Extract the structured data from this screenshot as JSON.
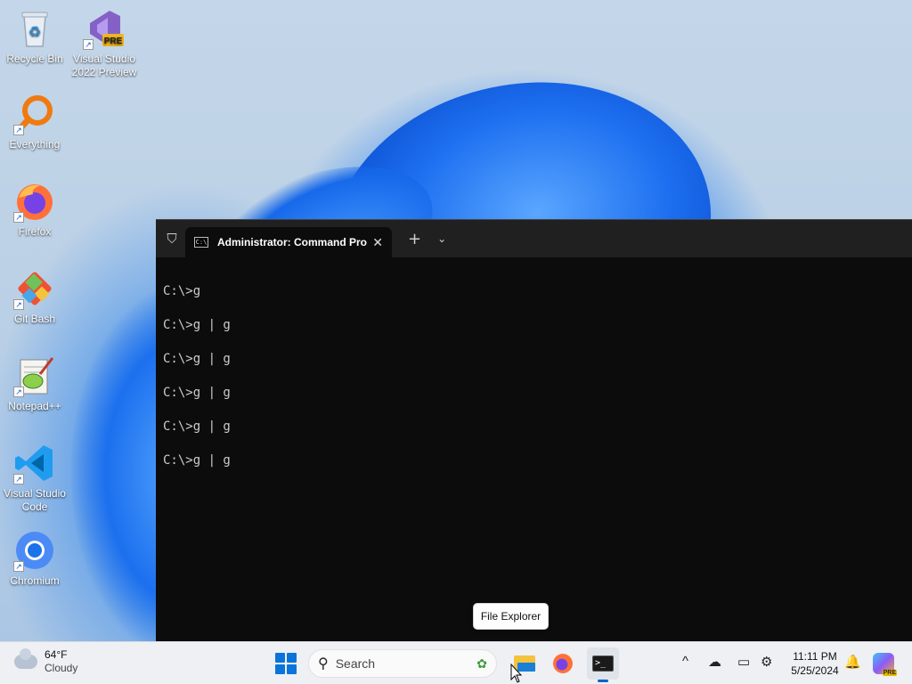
{
  "desktop": {
    "icons": [
      {
        "label": "Recycle Bin",
        "icon": "recycle-bin-icon"
      },
      {
        "label": "Visual Studio 2022 Preview",
        "icon": "visual-studio-preview-icon",
        "badge": "PRE"
      },
      {
        "label": "Everything",
        "icon": "everything-search-icon"
      },
      {
        "label": "Firefox",
        "icon": "firefox-icon"
      },
      {
        "label": "Git Bash",
        "icon": "git-bash-icon"
      },
      {
        "label": "Notepad++",
        "icon": "notepad-plus-plus-icon"
      },
      {
        "label": "Visual Studio Code",
        "icon": "vscode-icon"
      },
      {
        "label": "Chromium",
        "icon": "chromium-icon"
      }
    ]
  },
  "terminal": {
    "tab_title": "Administrator: Command Pro",
    "tab_icon_text": "C:\\",
    "close_glyph": "✕",
    "new_tab_glyph": "+",
    "dropdown_glyph": "⌄",
    "shield_glyph": "⛉",
    "lines": [
      "C:\\>g",
      "C:\\>g | g",
      "C:\\>g | g",
      "C:\\>g | g",
      "C:\\>g | g",
      "C:\\>g | g"
    ]
  },
  "tooltip": {
    "text": "File Explorer"
  },
  "taskbar": {
    "weather": {
      "temp": "64°F",
      "condition": "Cloudy"
    },
    "search": {
      "placeholder": "Search"
    },
    "apps": [
      {
        "name": "file-explorer",
        "icon": "folder-icon"
      },
      {
        "name": "firefox",
        "icon": "firefox-icon"
      },
      {
        "name": "windows-terminal",
        "icon": "terminal-icon",
        "active": true
      }
    ],
    "tray": {
      "chevron": "^",
      "time": "11:11 PM",
      "date": "5/25/2024",
      "copilot_badge": "PRE"
    }
  },
  "colors": {
    "terminal_bg": "#0c0c0c",
    "taskbar_bg": "#eef0f4",
    "accent": "#0a74da"
  }
}
